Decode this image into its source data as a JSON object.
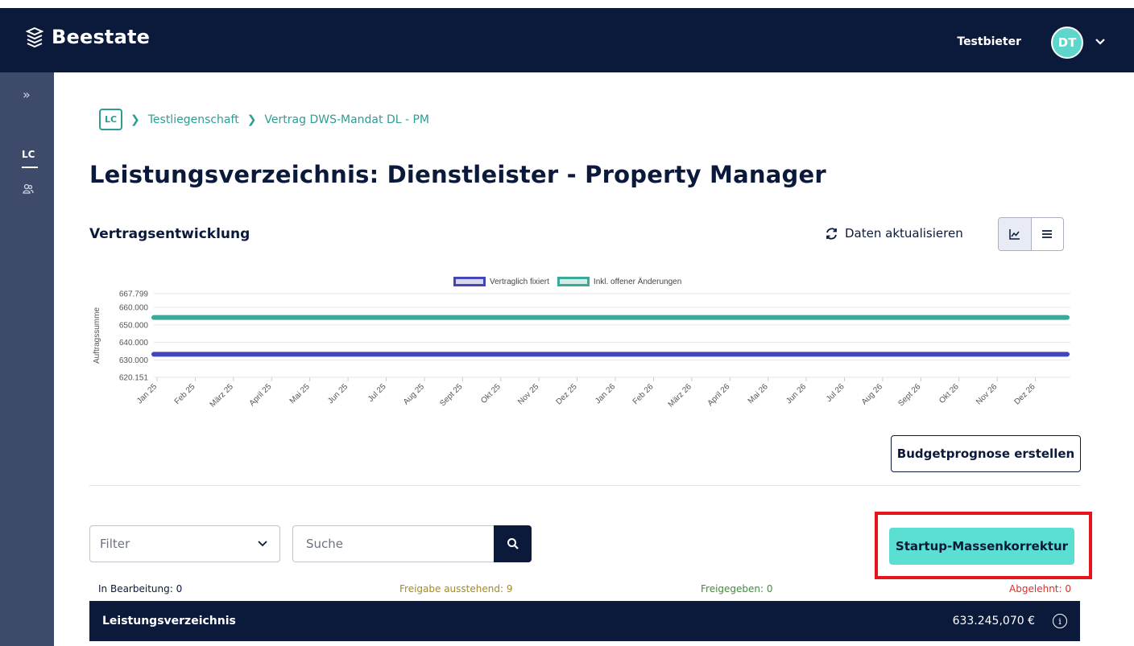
{
  "app": {
    "brand": "Beestate"
  },
  "header": {
    "user_name": "Testbieter",
    "avatar_initials": "DT"
  },
  "sidebar": {
    "section_label": "LC"
  },
  "breadcrumb": {
    "root_badge": "LC",
    "items": [
      "Testliegenschaft",
      "Vertrag DWS-Mandat DL - PM"
    ]
  },
  "page": {
    "title": "Leistungsverzeichnis: Dienstleister - Property Manager"
  },
  "section": {
    "title": "Vertragsentwicklung",
    "refresh_label": "Daten aktualisieren"
  },
  "chart_data": {
    "type": "line",
    "title": "",
    "xlabel": "",
    "ylabel": "Auftragssumme",
    "y_tick_labels": [
      "667.799",
      "660.000",
      "650.000",
      "640.000",
      "630.000",
      "620.151"
    ],
    "ylim": [
      620151,
      667799
    ],
    "categories": [
      "Jan 25",
      "Feb 25",
      "März 25",
      "April 25",
      "Mai 25",
      "Jun 25",
      "Jul 25",
      "Aug 25",
      "Sept 25",
      "Okt 25",
      "Nov 25",
      "Dez 25",
      "Jan 26",
      "Feb 26",
      "März 26",
      "April 26",
      "Mai 26",
      "Jun 26",
      "Jul 26",
      "Aug 26",
      "Sept 26",
      "Okt 26",
      "Nov 26",
      "Dez 26"
    ],
    "series": [
      {
        "name": "Vertraglich fixiert",
        "color": "#4346b8",
        "fill": "#d8d9ee",
        "value": 633245
      },
      {
        "name": "Inkl. offener Änderungen",
        "color": "#3aa99a",
        "fill": "#d4ece8",
        "value": 654200
      }
    ],
    "grid": true,
    "legend": "top-center"
  },
  "actions": {
    "budget_button": "Budgetprognose erstellen",
    "startup_button": "Startup-Massenkorrektur"
  },
  "filter": {
    "placeholder": "Filter"
  },
  "search": {
    "placeholder": "Suche"
  },
  "status": {
    "in_progress": "In Bearbeitung: 0",
    "pending": "Freigabe ausstehend: 9",
    "released": "Freigegeben: 0",
    "rejected": "Abgelehnt: 0"
  },
  "table": {
    "header_label": "Leistungsverzeichnis",
    "total": "633.245,070 €"
  },
  "colors": {
    "navy": "#0b1a3b",
    "teal": "#5cdfd3",
    "highlight": "#e8141d"
  }
}
